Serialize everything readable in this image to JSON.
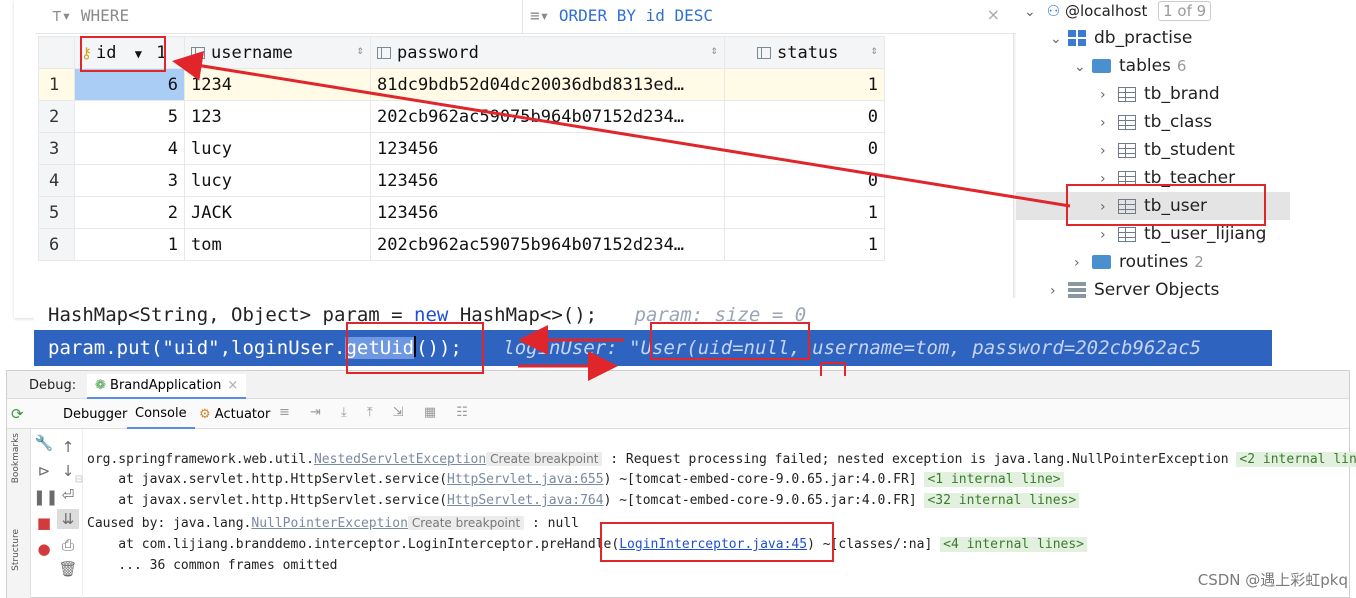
{
  "filter": {
    "where": "WHERE",
    "order": "ORDER BY id DESC",
    "close": "×"
  },
  "grid": {
    "columns": [
      "id",
      "username",
      "password",
      "status"
    ],
    "header_marks": {
      "id_sort": "▼",
      "id_sort_order": "1",
      "sort_arrows": "⇕"
    },
    "rows": [
      {
        "rownum": "1",
        "id": "6",
        "username": "1234",
        "password": "81dc9bdb52d04dc20036dbd8313ed…",
        "status": "1"
      },
      {
        "rownum": "2",
        "id": "5",
        "username": "123",
        "password": "202cb962ac59075b964b07152d234…",
        "status": "0"
      },
      {
        "rownum": "3",
        "id": "4",
        "username": "lucy",
        "password": "123456",
        "status": "0"
      },
      {
        "rownum": "4",
        "id": "3",
        "username": "lucy",
        "password": "123456",
        "status": "0"
      },
      {
        "rownum": "5",
        "id": "2",
        "username": "JACK",
        "password": "123456",
        "status": "1"
      },
      {
        "rownum": "6",
        "id": "1",
        "username": "tom",
        "password": "202cb962ac59075b964b07152d234…",
        "status": "1"
      }
    ]
  },
  "tree": {
    "host": "@localhost",
    "host_count": "1 of 9",
    "db": "db_practise",
    "tables_label": "tables",
    "tables_count": "6",
    "tables": [
      "tb_brand",
      "tb_class",
      "tb_student",
      "tb_teacher",
      "tb_user",
      "tb_user_lijiang"
    ],
    "routines_label": "routines",
    "routines_count": "2",
    "server_objects": "Server Objects"
  },
  "code": {
    "line1": "HashMap<String, Object> param = ",
    "line1_kw": "new",
    "line1_rest": " HashMap<>();",
    "line1_hint": "param:  size = 0",
    "line2_a": "param.put(\"uid\",loginUse",
    "line2_b": "r.",
    "line2_sel": "getUid",
    "line2_c": "());",
    "line2_hint": "loginUser: \"User(uid=null, username=tom, password=202cb962ac5"
  },
  "debug": {
    "label": "Debug:",
    "config": "BrandApplication",
    "tabs": [
      "Debugger",
      "Console",
      "Actuator"
    ],
    "active_tab": "Console",
    "side_labels": [
      "Bookmarks",
      "Structure"
    ],
    "console": {
      "l1_a": "org.springframework.web.util.",
      "l1_link": "NestedServletException",
      "l1_bp": "Create breakpoint",
      "l1_b": " : Request processing failed; nested exception is java.lang.NullPointerException ",
      "l1_il": "<2 internal lin",
      "l2_a": "    at javax.servlet.http.HttpServlet.service(",
      "l2_link": "HttpServlet.java:655",
      "l2_b": ") ~[tomcat-embed-core-9.0.65.jar:4.0.FR] ",
      "l2_il": "<1 internal line>",
      "l3_a": "    at javax.servlet.http.HttpServlet.service(",
      "l3_link": "HttpServlet.java:764",
      "l3_b": ") ~[tomcat-embed-core-9.0.65.jar:4.0.FR] ",
      "l3_il": "<32 internal lines>",
      "l4_a": "Caused by: java.lang.",
      "l4_link": "NullPointerException",
      "l4_bp": "Create breakpoint",
      "l4_b": " : null",
      "l5_a": "    at com.lijiang.branddemo.interceptor.LoginInterceptor.preHandle(",
      "l5_link": "LoginInterceptor.java:45",
      "l5_b": ") ~[classes/:na] ",
      "l5_il": "<4 internal lines>",
      "l6": "    ... 36 common frames omitted"
    }
  },
  "watermark": "CSDN @遇上彩虹pkq",
  "colors": {
    "annotation": "#e0262b",
    "selection": "#2f63c0",
    "link": "#1f4fd6"
  }
}
